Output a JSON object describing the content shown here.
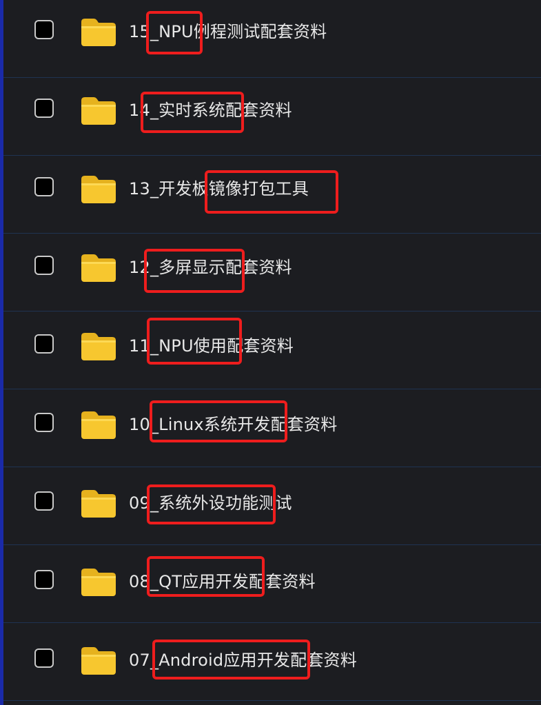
{
  "files": [
    {
      "name": "15_NPU例程测试配套资料"
    },
    {
      "name": "14_实时系统配套资料"
    },
    {
      "name": "13_开发板镜像打包工具"
    },
    {
      "name": "12_多屏显示配套资料"
    },
    {
      "name": "11_NPU使用配套资料"
    },
    {
      "name": "10_Linux系统开发配套资料"
    },
    {
      "name": "09_系统外设功能测试"
    },
    {
      "name": "08_QT应用开发配套资料"
    },
    {
      "name": "07_Android应用开发配套资料"
    }
  ],
  "colors": {
    "background": "#1c1d21",
    "folder": "#f7c72f",
    "highlight": "#ee1d1d",
    "text": "#e8e8e8",
    "row_divider": "#1f3352"
  },
  "icons": {
    "folder": "folder-icon",
    "checkbox": "checkbox"
  }
}
